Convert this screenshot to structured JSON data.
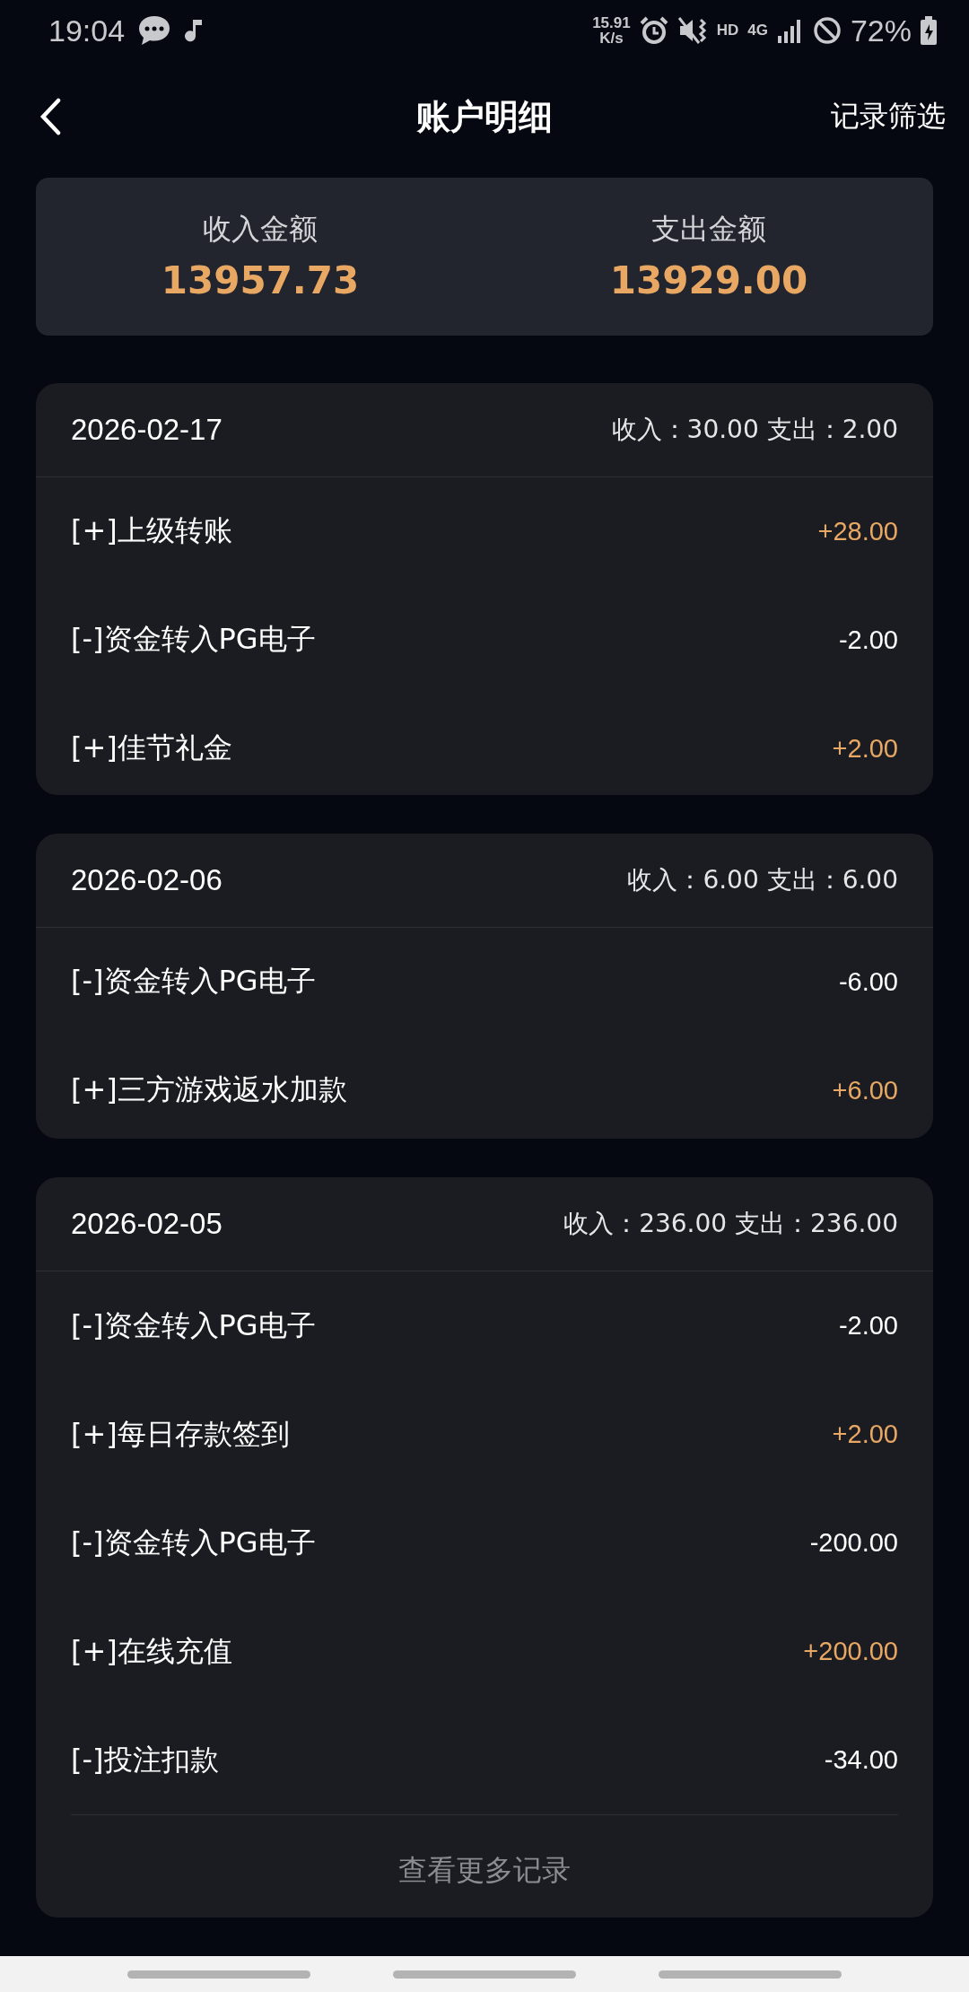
{
  "status_bar": {
    "time": "19:04",
    "net_speed": "15.91",
    "net_unit": "K/s",
    "hd": "HD",
    "network": "4G",
    "battery": "72%"
  },
  "header": {
    "title": "账户明细",
    "action": "记录筛选"
  },
  "summary": [
    {
      "label": "收入金额",
      "amount": "13957.73"
    },
    {
      "label": "支出金额",
      "amount": "13929.00"
    }
  ],
  "groups": [
    {
      "date": "2026-02-17",
      "totals": "收入：30.00 支出：2.00",
      "rows": [
        {
          "title": "[+]上级转账",
          "amount": "+28.00",
          "kind": "income"
        },
        {
          "title": "[-]资金转入PG电子",
          "amount": "-2.00",
          "kind": "expense"
        },
        {
          "title": "[+]佳节礼金",
          "amount": "+2.00",
          "kind": "income"
        }
      ]
    },
    {
      "date": "2026-02-06",
      "totals": "收入：6.00 支出：6.00",
      "rows": [
        {
          "title": "[-]资金转入PG电子",
          "amount": "-6.00",
          "kind": "expense"
        },
        {
          "title": "[+]三方游戏返水加款",
          "amount": "+6.00",
          "kind": "income"
        }
      ]
    },
    {
      "date": "2026-02-05",
      "totals": "收入：236.00 支出：236.00",
      "more": "查看更多记录",
      "rows": [
        {
          "title": "[-]资金转入PG电子",
          "amount": "-2.00",
          "kind": "expense"
        },
        {
          "title": "[+]每日存款签到",
          "amount": "+2.00",
          "kind": "income"
        },
        {
          "title": "[-]资金转入PG电子",
          "amount": "-200.00",
          "kind": "expense"
        },
        {
          "title": "[+]在线充值",
          "amount": "+200.00",
          "kind": "income"
        },
        {
          "title": "[-]投注扣款",
          "amount": "-34.00",
          "kind": "expense"
        }
      ]
    }
  ]
}
